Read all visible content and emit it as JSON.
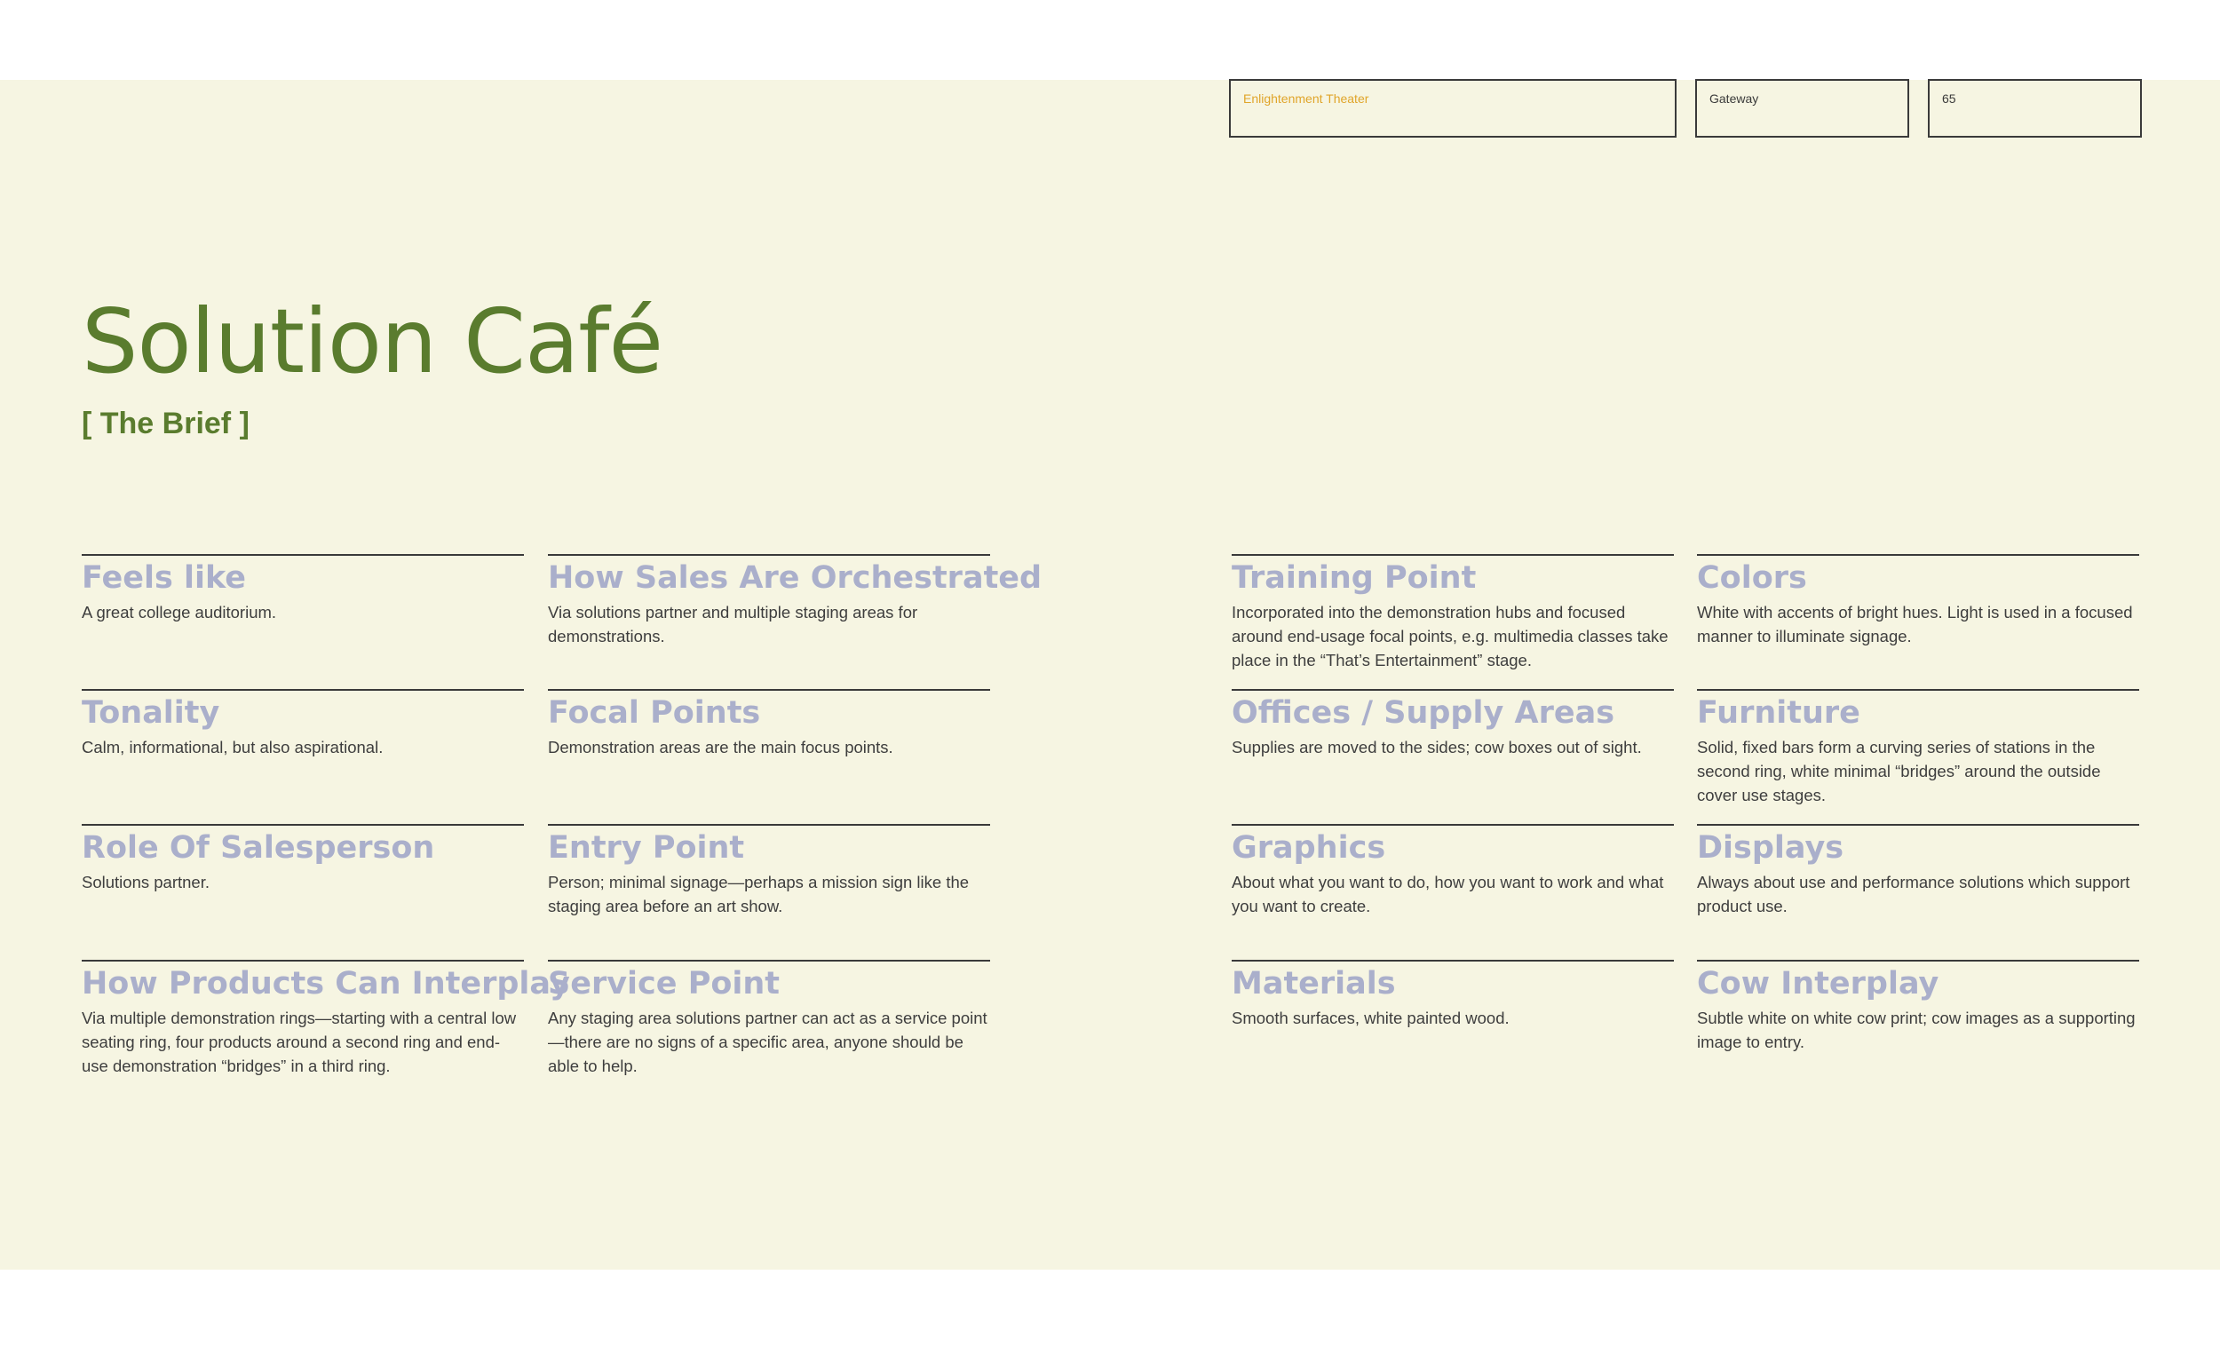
{
  "header": {
    "section": "Enlightenment Theater",
    "chapter": "Gateway",
    "page_number": "65"
  },
  "title": "Solution Café",
  "subtitle": "[ The Brief ]",
  "items": [
    {
      "heading": "Feels like",
      "body": "A great college auditorium."
    },
    {
      "heading": "How Sales Are Orchestrated",
      "body": "Via solutions partner and multiple staging areas for demonstrations."
    },
    {
      "heading": "Training Point",
      "body": "Incorporated into the demonstration hubs and focused around end-usage focal points, e.g. multimedia classes take place in the “That’s Entertainment” stage."
    },
    {
      "heading": "Colors",
      "body": "White with accents of bright hues. Light is used in a focused manner to illuminate signage."
    },
    {
      "heading": "Tonality",
      "body": "Calm, informational, but also aspirational."
    },
    {
      "heading": "Focal Points",
      "body": "Demonstration areas are the main focus points."
    },
    {
      "heading": "Offices / Supply Areas",
      "body": "Supplies are moved to the sides; cow boxes out of sight."
    },
    {
      "heading": "Furniture",
      "body": "Solid, fixed bars form a curving series of stations in the second ring, white minimal “bridges” around the outside cover use stages."
    },
    {
      "heading": "Role Of Salesperson",
      "body": "Solutions partner."
    },
    {
      "heading": "Entry Point",
      "body": "Person; minimal signage—perhaps a mission sign like the staging area before an art show."
    },
    {
      "heading": "Graphics",
      "body": "About what you want to do, how you want to work and what you want to create."
    },
    {
      "heading": "Displays",
      "body": "Always about use and performance solutions which support product use."
    },
    {
      "heading": "How Products Can Interplay",
      "body": "Via multiple demonstration rings—starting with a central low seating ring, four products around a second ring and end-use demonstration “bridges” in a third ring."
    },
    {
      "heading": "Service Point",
      "body": "Any staging area solutions partner can act as a service point—there are no signs of a specific area, anyone should be able to help."
    },
    {
      "heading": "Materials",
      "body": "Smooth surfaces, white painted wood."
    },
    {
      "heading": "Cow Interplay",
      "body": "Subtle white on white cow print; cow images as a supporting image to entry."
    }
  ]
}
